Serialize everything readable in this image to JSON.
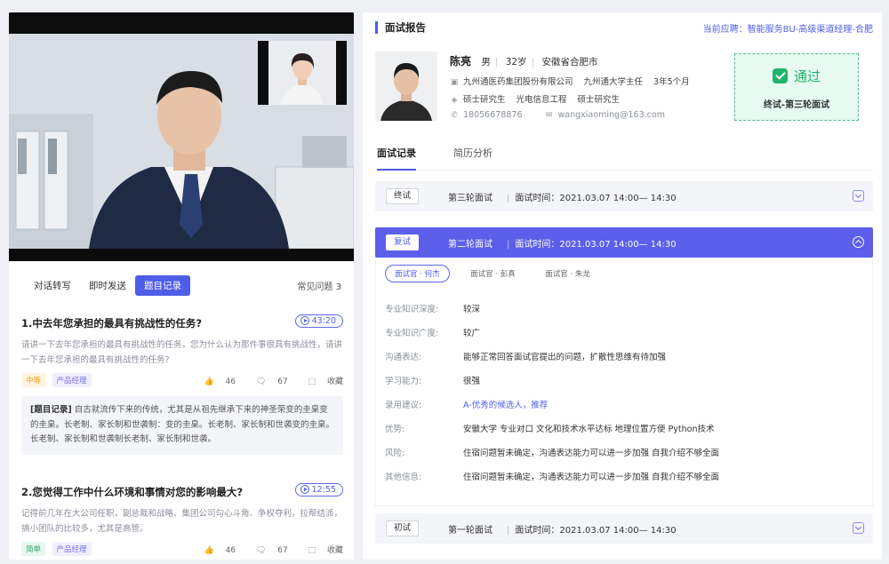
{
  "left": {
    "tabs": [
      "对话转写",
      "即时发送",
      "题目记录"
    ],
    "faq": "常见问题",
    "faq_count": "3",
    "questions": [
      {
        "title": "1.中去年您承担的最具有挑战性的任务?",
        "time": "43:20",
        "desc": "请讲一下去年您承担的最具有挑战性的任务，您为什么认为那件事很具有挑战性，请讲一下去年您承担的最具有挑战性的任务?",
        "tags": [
          "中等",
          "产品经理"
        ],
        "likes": "46",
        "comments": "67",
        "fav": "收藏",
        "record_label": "[题目记录]",
        "record": "自古就流传下来的传统，尤其是从祖先继承下来的神圣荣变的圭臬变的圭臬。长老制、家长制和世袭制：变的圭臬。长老制、家长制和世袭变的圭臬。长老制、家长制和世袭制长老制、家长制和世袭。"
      },
      {
        "title": "2.您觉得工作中什么环境和事情对您的影响最大?",
        "time": "12:55",
        "desc": "记得前几年在大公司任职，副总裁和战略、集团公司勾心斗角、争权夺利，拉帮结派，搞小团队的比较多，尤其是高管。",
        "tags": [
          "简单",
          "产品经理"
        ],
        "likes": "46",
        "comments": "67",
        "fav": "收藏"
      }
    ]
  },
  "right": {
    "title": "面试报告",
    "apply": "当前应聘：智能服务BU-高级渠道经理-合肥",
    "candidate": {
      "name": "陈亮",
      "gender": "男",
      "age": "32岁",
      "location": "安徽省合肥市",
      "company": "九州通医药集团股份有限公司",
      "position": "九州通大学主任",
      "tenure": "3年5个月",
      "degree": "硕士研究生",
      "major": "光电信息工程",
      "degree2": "硕士研究生",
      "phone": "18056678876",
      "email": "wangxiaoming@163.com"
    },
    "result": {
      "status": "通过",
      "stage": "终试-第三轮面试"
    },
    "tabs": [
      "面试记录",
      "简历分析"
    ],
    "time_label": "面试时间：",
    "rounds": [
      {
        "badge": "终试",
        "name": "第三轮面试",
        "time": "2021.03.07 14:00— 14:30"
      },
      {
        "badge": "复试",
        "name": "第二轮面试",
        "time": "2021.03.07 14:00— 14:30"
      },
      {
        "badge": "初试",
        "name": "第一轮面试",
        "time": "2021.03.07 14:00— 14:30"
      }
    ],
    "interviewers": [
      "面试官 · 何杰",
      "面试官 · 彭真",
      "面试官 · 朱龙"
    ],
    "details": [
      {
        "label": "专业知识深度:",
        "value": "较深"
      },
      {
        "label": "专业知识广度:",
        "value": "较广"
      },
      {
        "label": "沟通表达:",
        "value": "能够正常回答面试官提出的问题，扩散性思维有待加强"
      },
      {
        "label": "学习能力:",
        "value": "很强"
      },
      {
        "label": "录用建议:",
        "value": "A-优秀的候选人，推荐"
      },
      {
        "label": "优势:",
        "value": "安徽大学 专业对口 文化和技术水平达标 地理位置方便 Python技术"
      },
      {
        "label": "风险:",
        "value": "住宿问题暂未确定，沟通表达能力可以进一步加强 自我介绍不够全面"
      },
      {
        "label": "其他信息:",
        "value": "住宿问题暂未确定，沟通表达能力可以进一步加强 自我介绍不够全面"
      }
    ]
  },
  "colors": {
    "accent": "#4f5ee8",
    "pass_green": "#22b36a",
    "pass_bg": "#e6faf0"
  }
}
